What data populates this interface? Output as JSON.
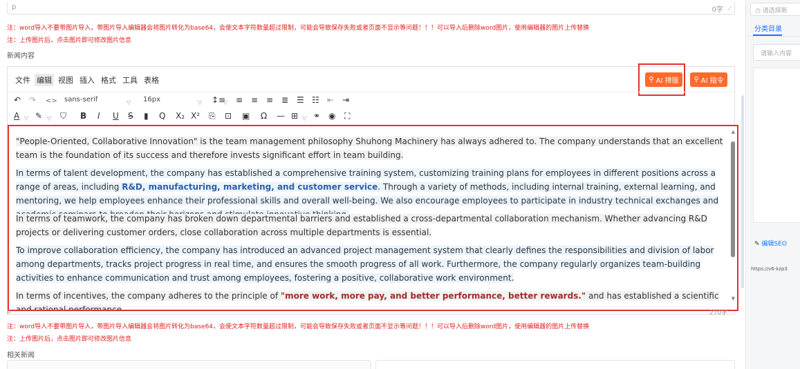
{
  "top_editor": {
    "tag": "p",
    "count": "0字"
  },
  "notes": {
    "word_warning": "注：word导入不要带图片导入，带图片导入编辑器会将图片转化为base64，会使文本字符数量超过限制，可能会导致保存失败或者页面不显示等问题！！！可以导入后删除word图片，使用编辑器的图片上传替换",
    "image_tip": "注：上传图片后，点击图片即可修改图片信息"
  },
  "labels": {
    "news_content": "新闻内容",
    "related_news": "相关新闻"
  },
  "menubar": {
    "items": [
      "文件",
      "编辑",
      "视图",
      "插入",
      "格式",
      "工具",
      "表格"
    ],
    "active_index": 1
  },
  "ai_buttons": {
    "ai_format": "AI 排版",
    "ai_command": "AI 指令"
  },
  "toolbar": {
    "font_family": "sans-serif",
    "font_size": "16px"
  },
  "content": {
    "p1": "\"People-Oriented, Collaborative Innovation\" is the team management philosophy Shuhong Machinery has always adhered to. The company understands that an excellent team is the foundation of its success and therefore invests significant effort in team building.",
    "p2_before": "In terms of talent development, the company has established a comprehensive training system, customizing training plans for employees in different positions across a range of areas, including ",
    "p2_bold": "R&D, manufacturing, marketing, and customer service",
    "p2_after": ". Through a variety of methods, including internal training, external learning, and mentoring, we help employees enhance their professional skills and overall well-being. We also encourage employees to participate in industry technical exchanges and academic seminars to broaden their horizons and stimulate innovative thinking.",
    "p3": "In terms of teamwork, the company has broken down departmental barriers and established a cross-departmental collaboration mechanism. Whether advancing R&D projects or delivering customer orders, close collaboration across multiple departments is essential.",
    "p4": "To improve collaboration efficiency, the company has introduced an advanced project management system that clearly defines the responsibilities and division of labor among departments, tracks project progress in real time, and ensures the smooth progress of all work. Furthermore, the company regularly organizes team-building activities to enhance communication and trust among employees, fostering a positive, collaborative work environment.",
    "p5_before": "In terms of incentives, the company adheres to the principle of ",
    "p5_bold": "\"more work, more pay, and better performance, better rewards.\"",
    "p5_after": " and has established a scientific and rational performance"
  },
  "bottom_editor": {
    "tag": "p",
    "count": "270字"
  },
  "right_panel": {
    "select_placeholder": "请选择新",
    "tab": "分类目录",
    "input_placeholder": "请输入内容",
    "seo_label": "编辑SEO",
    "url": "https://v6-kzp3"
  },
  "colors": {
    "accent": "#ff6a2c",
    "highlight_border": "#e03131",
    "warning": "#e02020",
    "link": "#1677ff"
  }
}
